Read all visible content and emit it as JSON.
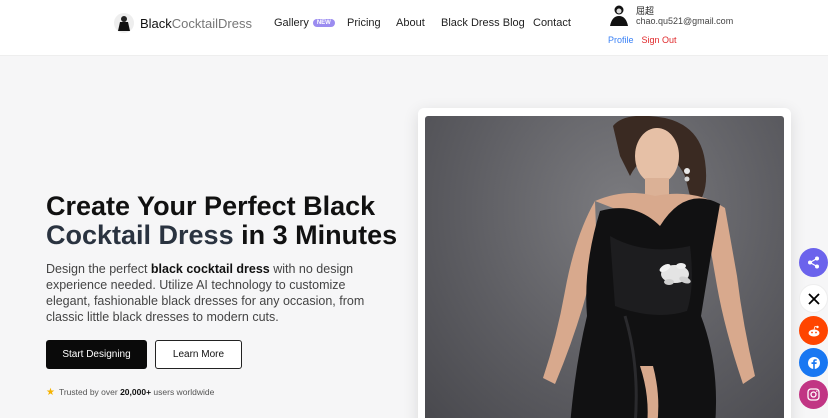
{
  "header": {
    "logo": {
      "part1": "Black",
      "part2": "CocktailDress"
    },
    "nav": [
      {
        "label": "Gallery",
        "badge": "NEW"
      },
      {
        "label": "Pricing"
      },
      {
        "label": "About"
      },
      {
        "label": "Black Dress Blog"
      },
      {
        "label": "Contact"
      }
    ],
    "user": {
      "name": "屈超",
      "email": "chao.qu521@gmail.com",
      "profile_label": "Profile",
      "signout_label": "Sign Out"
    }
  },
  "hero": {
    "title_part1": "Create Your Perfect Black",
    "title_accent": "Cocktail Dress",
    "title_part2": " in 3 Minutes",
    "desc_part1": "Design the perfect ",
    "desc_bold": "black cocktail dress",
    "desc_part2": " with no design experience needed. Utilize AI technology to customize elegant, fashionable black dresses for any occasion, from classic little black dresses to modern cuts.",
    "primary_button": "Start Designing",
    "secondary_button": "Learn More",
    "trusted_prefix": "Trusted by over ",
    "trusted_count": "20,000+",
    "trusted_suffix": " users worldwide"
  },
  "social": {
    "items": [
      "share-icon",
      "x-icon",
      "reddit-icon",
      "facebook-icon",
      "instagram-icon"
    ],
    "colors": {
      "share": "#6b63ec",
      "x": "#000000",
      "reddit": "#ff4500",
      "facebook": "#1877f2",
      "instagram": "#c13584"
    }
  }
}
